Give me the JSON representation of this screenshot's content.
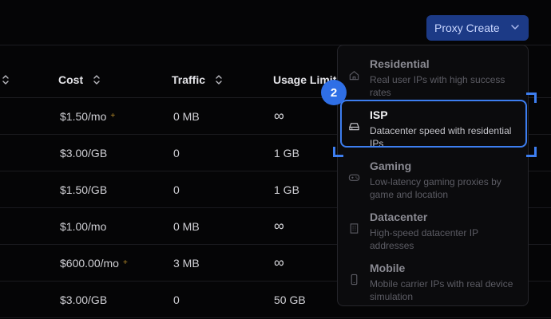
{
  "header": {
    "proxy_create_label": "Proxy Create"
  },
  "table": {
    "columns": [
      {
        "label": "Cost"
      },
      {
        "label": "Traffic"
      },
      {
        "label": "Usage Limit"
      }
    ],
    "rows": [
      {
        "cost": "$1.50/mo",
        "cost_extra": "+",
        "traffic": "0 MB",
        "limit": "∞"
      },
      {
        "cost": "$3.00/GB",
        "cost_extra": "",
        "traffic": "0",
        "limit": "1 GB"
      },
      {
        "cost": "$1.50/GB",
        "cost_extra": "",
        "traffic": "0",
        "limit": "1 GB"
      },
      {
        "cost": "$1.00/mo",
        "cost_extra": "",
        "traffic": "0 MB",
        "limit": "∞"
      },
      {
        "cost": "$600.00/mo",
        "cost_extra": "+",
        "traffic": "3 MB",
        "limit": "∞"
      },
      {
        "cost": "$3.00/GB",
        "cost_extra": "",
        "traffic": "0",
        "limit": "50 GB"
      }
    ]
  },
  "menu": {
    "items": [
      {
        "title": "Residential",
        "desc": "Real user IPs with high success rates",
        "icon": "home-icon"
      },
      {
        "title": "ISP",
        "desc": "Datacenter speed with residential IPs",
        "icon": "hard-drive-icon"
      },
      {
        "title": "Gaming",
        "desc": "Low-latency gaming proxies by game and location",
        "icon": "gamepad-icon"
      },
      {
        "title": "Datacenter",
        "desc": "High-speed datacenter IP addresses",
        "icon": "building-icon"
      },
      {
        "title": "Mobile",
        "desc": "Mobile carrier IPs with real device simulation",
        "icon": "smartphone-icon"
      }
    ]
  },
  "annotation": {
    "step_number": "2"
  },
  "colors": {
    "accent": "#3d7ef0",
    "button_bg": "#1c3a86",
    "plus_gold": "#b58a2a"
  }
}
